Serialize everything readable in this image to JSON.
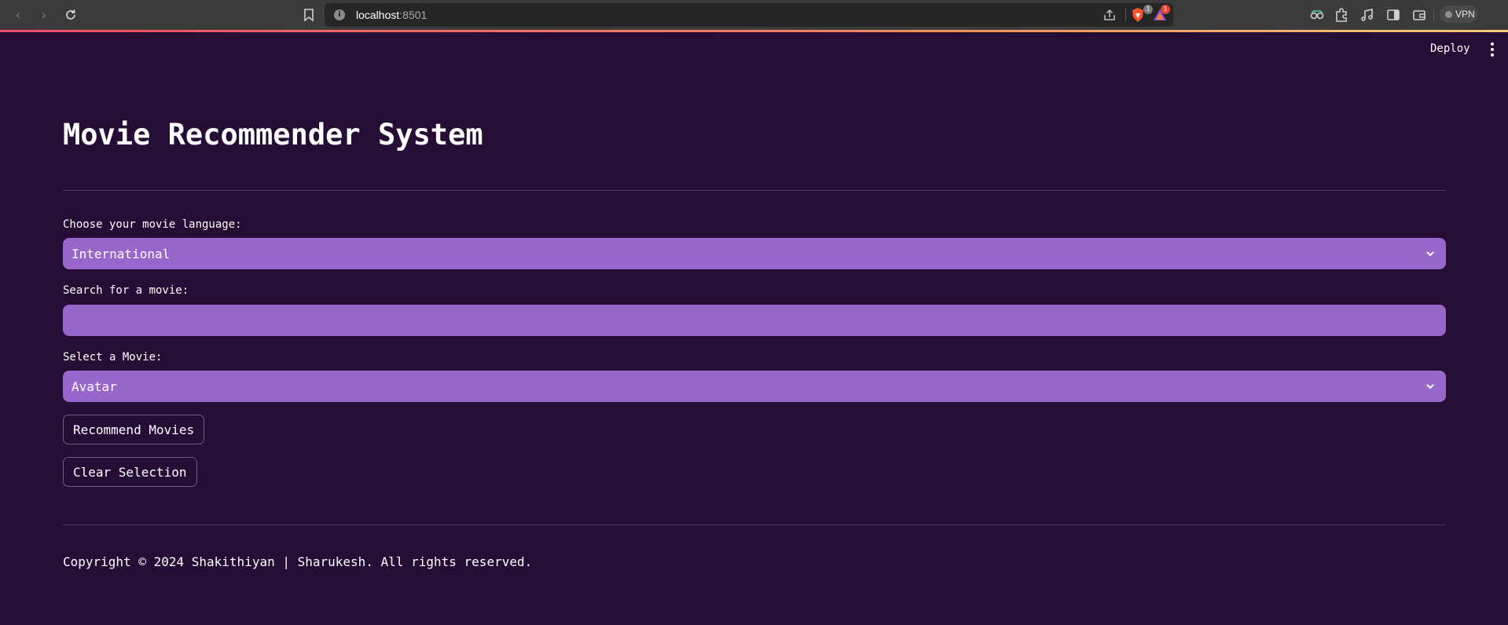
{
  "browser": {
    "url_host": "localhost",
    "url_port": ":8501",
    "brave_shields_count": "1",
    "rewards_count": "1",
    "vpn_label": "VPN"
  },
  "header": {
    "deploy_label": "Deploy"
  },
  "main": {
    "title": "Movie Recommender System",
    "language_label": "Choose your movie language:",
    "language_value": "International",
    "search_label": "Search for a movie:",
    "search_value": "",
    "movie_label": "Select a Movie:",
    "movie_value": "Avatar",
    "recommend_button": "Recommend Movies",
    "clear_button": "Clear Selection"
  },
  "footer": {
    "copyright": "Copyright © 2024 Shakithiyan | Sharukesh. All rights reserved."
  },
  "colors": {
    "background": "#250d35",
    "field_fill": "#9966cc",
    "divider": "#4f3b5c"
  }
}
